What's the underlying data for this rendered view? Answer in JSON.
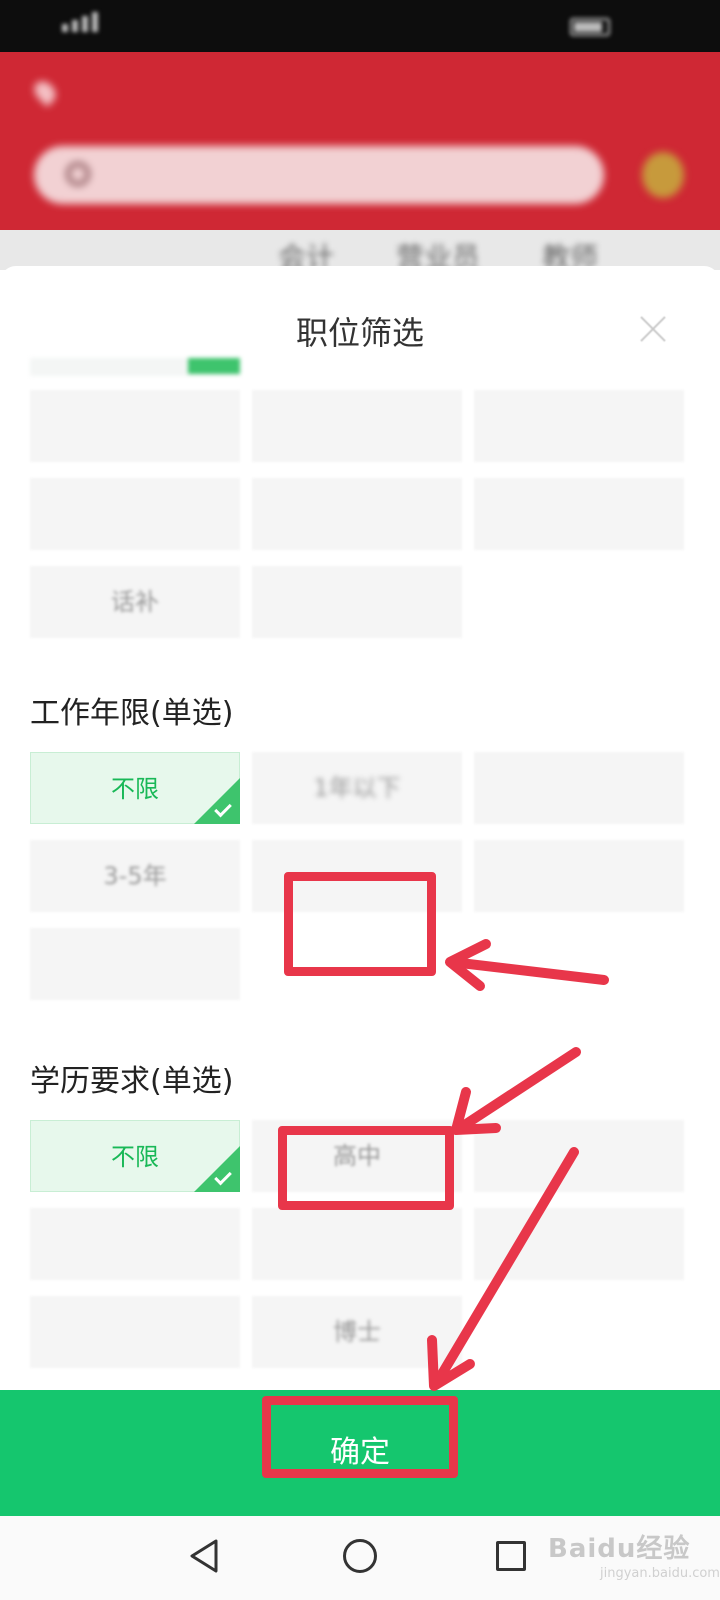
{
  "status_bar": {
    "carrier": "",
    "time": ""
  },
  "background_app": {
    "location": "",
    "logo": "",
    "slogan": "",
    "brand": "",
    "search_placeholder": "",
    "tabs": [
      "",
      "",
      "会计",
      "营业员",
      "教师"
    ]
  },
  "sheet": {
    "title": "职位筛选",
    "category_chips": [
      "",
      "",
      "",
      "",
      "",
      "",
      "话补",
      ""
    ],
    "work_years": {
      "label": "工作年限(单选)",
      "options": [
        "不限",
        "1年以下",
        "",
        "3-5年",
        "",
        "",
        ""
      ],
      "selected": "不限"
    },
    "education": {
      "label": "学历要求(单选)",
      "options": [
        "不限",
        "高中",
        "",
        "",
        "",
        "",
        "",
        "博士"
      ],
      "selected": "不限"
    },
    "confirm_label": "确定"
  },
  "watermark": {
    "text": "Baidu经验",
    "sub": "jingyan.baidu.com"
  },
  "colors": {
    "accent_green": "#15c66e",
    "selected_bg": "#e7f8ec",
    "header_red": "#cf2834",
    "annotation_red": "#e8364a"
  }
}
